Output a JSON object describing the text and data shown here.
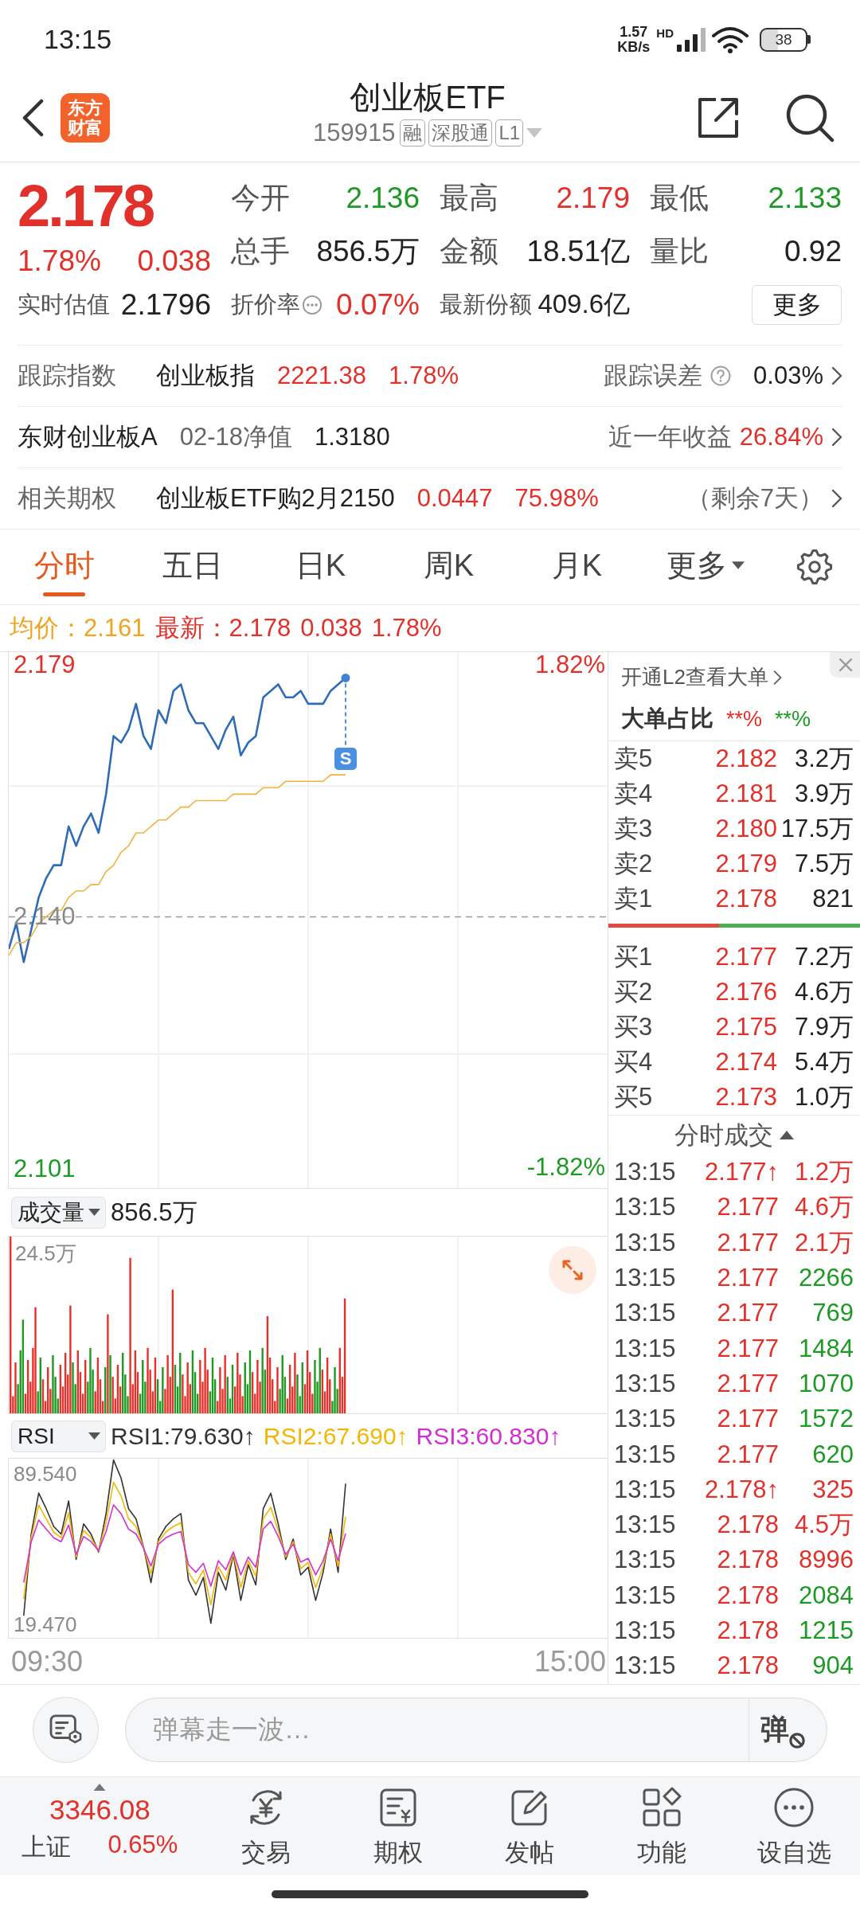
{
  "status_bar": {
    "time": "13:15",
    "speed": "1.57",
    "speed_unit": "KB/s",
    "network": "HD",
    "battery": "38"
  },
  "header": {
    "logo": "东方财富",
    "title": "创业板ETF",
    "code": "159915",
    "tags": [
      "融",
      "深股通",
      "L1"
    ]
  },
  "quote": {
    "price": "2.178",
    "change_pct": "1.78%",
    "change": "0.038",
    "color": "#e2302b",
    "stats": [
      {
        "label": "今开",
        "value": "2.136",
        "color": "#1c9a24"
      },
      {
        "label": "最高",
        "value": "2.179",
        "color": "#e2302b"
      },
      {
        "label": "最低",
        "value": "2.133",
        "color": "#1c9a24"
      },
      {
        "label": "总手",
        "value": "856.5万",
        "color": "#222222"
      },
      {
        "label": "金额",
        "value": "18.51亿",
        "color": "#222222"
      },
      {
        "label": "量比",
        "value": "0.92",
        "color": "#222222"
      }
    ],
    "details": [
      {
        "label": "实时估值",
        "value": "2.1796",
        "color": "#222222",
        "info": false
      },
      {
        "label": "折价率",
        "value": "0.07%",
        "color": "#e2302b",
        "info": true
      },
      {
        "label": "最新份额",
        "value": "409.6亿",
        "color": "#222222",
        "info": false
      }
    ],
    "more_button": "更多"
  },
  "info_rows": [
    {
      "help": true,
      "left": [
        {
          "text": "跟踪指数",
          "color": "#666666"
        },
        {
          "text": "创业板指",
          "color": "#222222"
        },
        {
          "text": "2221.38",
          "color": "#e2302b"
        },
        {
          "text": "1.78%",
          "color": "#e2302b"
        }
      ],
      "right": [
        {
          "text": "跟踪误差",
          "color": "#666666"
        },
        {
          "text": "0.03%",
          "color": "#222222"
        }
      ]
    },
    {
      "help": false,
      "left": [
        {
          "text": "东财创业板A",
          "color": "#222222"
        },
        {
          "text": "02-18净值",
          "color": "#666666"
        },
        {
          "text": "1.3180",
          "color": "#222222"
        }
      ],
      "right": [
        {
          "text": "近一年收益",
          "color": "#666666"
        },
        {
          "text": "26.84%",
          "color": "#e2302b"
        }
      ]
    },
    {
      "help": false,
      "left": [
        {
          "text": "相关期权",
          "color": "#666666"
        },
        {
          "text": "创业板ETF购2月2150",
          "color": "#222222"
        },
        {
          "text": "0.0447",
          "color": "#e2302b"
        },
        {
          "text": "75.98%",
          "color": "#e2302b"
        }
      ],
      "right": [
        {
          "text": "（剩余7天）",
          "color": "#666666"
        }
      ]
    }
  ],
  "tabs": [
    {
      "label": "分时",
      "selected": true,
      "dropdown": false
    },
    {
      "label": "五日",
      "selected": false,
      "dropdown": false
    },
    {
      "label": "日K",
      "selected": false,
      "dropdown": false
    },
    {
      "label": "周K",
      "selected": false,
      "dropdown": false
    },
    {
      "label": "月K",
      "selected": false,
      "dropdown": false
    },
    {
      "label": "更多",
      "selected": false,
      "dropdown": true
    }
  ],
  "legend": {
    "average": "均价：2.161",
    "latest": "最新：2.178",
    "change": "0.038",
    "change_pct": "1.78%"
  },
  "price_chart": {
    "top_pct": "1.82%",
    "bottom_pct": "-1.82%",
    "chart_data": {
      "type": "line",
      "grid": true,
      "categories": [
        null,
        null,
        null,
        null,
        null,
        null,
        null,
        null,
        null,
        null,
        null,
        null,
        null,
        null,
        null,
        null,
        null,
        null,
        null,
        null,
        null,
        null,
        null,
        null,
        null,
        null,
        null,
        null,
        null,
        null,
        null,
        null,
        null,
        null,
        null,
        null,
        null,
        null,
        null,
        null,
        null,
        null,
        null,
        null,
        null,
        null,
        null,
        null,
        null,
        null,
        null,
        null,
        null,
        null,
        null,
        null,
        null,
        null,
        null,
        null,
        null,
        null,
        null,
        null,
        null,
        null,
        null,
        null,
        null,
        null,
        null,
        null,
        null,
        null,
        null,
        null,
        null,
        null,
        null,
        null,
        null
      ],
      "ylim": [
        2.098,
        2.181
      ],
      "yticks": [
        {
          "value": 2.179,
          "label": "2.179"
        },
        {
          "value": 2.14,
          "label": "2.140"
        },
        {
          "value": 2.101,
          "label": "2.101"
        }
      ],
      "ref_lines": [
        {
          "axis": "y",
          "value": 2.14
        }
      ],
      "series": [
        {
          "color": "#2f6cb5",
          "values": [
            2.135,
            2.139,
            2.133,
            2.138,
            2.143,
            2.146,
            2.148,
            2.148,
            2.154,
            2.151,
            2.154,
            2.156,
            2.153,
            2.159,
            2.168,
            2.167,
            2.169,
            2.173,
            2.168,
            2.166,
            2.172,
            2.17,
            2.175,
            2.176,
            2.172,
            2.17,
            2.17,
            2.168,
            2.166,
            2.169,
            2.171,
            2.165,
            2.167,
            2.168,
            2.174,
            2.175,
            2.176,
            2.174,
            2.174,
            2.175,
            2.173,
            2.173,
            2.173,
            2.175,
            2.176,
            2.177,
            null,
            null,
            null,
            null,
            null,
            null,
            null,
            null,
            null,
            null,
            null,
            null,
            null,
            null,
            null,
            null,
            null,
            null,
            null,
            null,
            null,
            null,
            null,
            null,
            null,
            null,
            null,
            null,
            null,
            null,
            null,
            null,
            null,
            null,
            null
          ]
        },
        {
          "color": "#f2b33d",
          "values": [
            2.134,
            2.136,
            2.136,
            2.137,
            2.139,
            2.14,
            2.141,
            2.141,
            2.143,
            2.144,
            2.144,
            2.145,
            2.145,
            2.147,
            2.148,
            2.15,
            2.151,
            2.153,
            2.153,
            2.154,
            2.155,
            2.155,
            2.156,
            2.157,
            2.157,
            2.158,
            2.158,
            2.158,
            2.158,
            2.158,
            2.159,
            2.159,
            2.159,
            2.159,
            2.16,
            2.16,
            2.16,
            2.161,
            2.161,
            2.161,
            2.161,
            2.161,
            2.161,
            2.162,
            2.162,
            2.162,
            null,
            null,
            null,
            null,
            null,
            null,
            null,
            null,
            null,
            null,
            null,
            null,
            null,
            null,
            null,
            null,
            null,
            null,
            null,
            null,
            null,
            null,
            null,
            null,
            null,
            null,
            null,
            null,
            null,
            null,
            null,
            null,
            null,
            null,
            null
          ]
        }
      ],
      "annotations": [
        "S"
      ]
    }
  },
  "volume": {
    "selector": "成交量",
    "total": "856.5万",
    "max_label": "24.5万"
  },
  "rsi": {
    "selector": "RSI",
    "readings": [
      {
        "text": "RSI1:79.630↑",
        "color": "#333333"
      },
      {
        "text": "RSI2:67.690↑",
        "color": "#f2b705"
      },
      {
        "text": "RSI3:60.830↑",
        "color": "#d42fd4"
      }
    ],
    "chart_data": {
      "type": "line",
      "grid": true,
      "categories": [
        null,
        null,
        null,
        null,
        null,
        null,
        null,
        null,
        null,
        null,
        null,
        null,
        null,
        null,
        null,
        null,
        null,
        null,
        null,
        null,
        null,
        null,
        null,
        null,
        null,
        null,
        null,
        null,
        null,
        null,
        null,
        null,
        null,
        null,
        null,
        null,
        null,
        null,
        null,
        null,
        null,
        null,
        null,
        null,
        null,
        null,
        null,
        null,
        null,
        null,
        null,
        null,
        null,
        null,
        null,
        null,
        null,
        null,
        null,
        null,
        null,
        null,
        null,
        null,
        null,
        null,
        null,
        null,
        null,
        null,
        null,
        null,
        null,
        null,
        null,
        null,
        null,
        null,
        null,
        null,
        null
      ],
      "ylim": [
        13.1,
        96.7
      ],
      "yticks": [
        {
          "value": 89.54,
          "label": "89.540"
        },
        {
          "value": 19.47,
          "label": "19.470"
        }
      ],
      "series": [
        {
          "color": "#333333",
          "values": [
            null,
            null,
            23.5,
            61.5,
            80.7,
            73.4,
            65.1,
            61.5,
            77.0,
            49.7,
            66.3,
            61.5,
            53.2,
            71.1,
            96.1,
            87.7,
            73.4,
            68.7,
            55.6,
            38.9,
            59.2,
            65.1,
            68.7,
            71.1,
            40.1,
            33.0,
            41.3,
            19.9,
            43.7,
            35.4,
            52.0,
            30.6,
            47.3,
            37.8,
            73.4,
            80.6,
            66.3,
            49.7,
            59.2,
            42.5,
            46.1,
            30.6,
            43.7,
            63.9,
            43.7,
            85.1,
            null,
            null,
            null,
            null,
            null,
            null,
            null,
            null,
            null,
            null,
            null,
            null,
            null,
            null,
            null,
            null,
            null,
            null,
            null,
            null,
            null,
            null,
            null,
            null,
            null,
            null,
            null,
            null,
            null,
            null,
            null,
            null,
            null,
            null,
            null
          ]
        },
        {
          "color": "#f2b705",
          "values": [
            null,
            null,
            31.2,
            59.8,
            75.0,
            68.7,
            62.5,
            59.8,
            71.4,
            50.8,
            63.3,
            59.8,
            53.6,
            66.9,
            85.7,
            79.4,
            68.7,
            65.1,
            55.4,
            42.9,
            58.0,
            62.5,
            65.1,
            66.9,
            43.7,
            38.3,
            44.7,
            28.6,
            46.4,
            40.1,
            52.6,
            36.6,
            49.1,
            41.9,
            68.7,
            74.0,
            63.3,
            50.8,
            58.0,
            45.5,
            48.2,
            36.6,
            46.4,
            61.6,
            46.4,
            69.6,
            null,
            null,
            null,
            null,
            null,
            null,
            null,
            null,
            null,
            null,
            null,
            null,
            null,
            null,
            null,
            null,
            null,
            null,
            null,
            null,
            null,
            null,
            null,
            null,
            null,
            null,
            null,
            null,
            null,
            null,
            null,
            null,
            null,
            null,
            null
          ]
        },
        {
          "color": "#d42fd4",
          "values": [
            null,
            null,
            39.0,
            58.0,
            68.1,
            63.9,
            59.8,
            58.0,
            65.7,
            52.0,
            60.4,
            58.0,
            53.8,
            62.7,
            75.2,
            71.1,
            63.9,
            61.6,
            55.0,
            46.7,
            56.8,
            59.8,
            61.6,
            62.7,
            47.3,
            43.7,
            47.9,
            37.2,
            49.1,
            44.9,
            53.2,
            42.5,
            50.8,
            46.1,
            63.9,
            67.5,
            60.4,
            52.0,
            56.8,
            48.5,
            50.2,
            42.5,
            49.1,
            59.2,
            49.1,
            61.8,
            null,
            null,
            null,
            null,
            null,
            null,
            null,
            null,
            null,
            null,
            null,
            null,
            null,
            null,
            null,
            null,
            null,
            null,
            null,
            null,
            null,
            null,
            null,
            null,
            null,
            null,
            null,
            null,
            null,
            null,
            null,
            null,
            null,
            null,
            null
          ]
        }
      ]
    },
    "time_axis": [
      "09:30",
      "15:00"
    ]
  },
  "order_book": {
    "l2_link": "开通L2查看大单",
    "big_order_label": "大单占比",
    "big_buy": "**%",
    "big_sell": "**%",
    "asks": [
      {
        "label": "卖5",
        "price": "2.182",
        "volume": "3.2万"
      },
      {
        "label": "卖4",
        "price": "2.181",
        "volume": "3.9万"
      },
      {
        "label": "卖3",
        "price": "2.180",
        "volume": "17.5万"
      },
      {
        "label": "卖2",
        "price": "2.179",
        "volume": "7.5万"
      },
      {
        "label": "卖1",
        "price": "2.178",
        "volume": "821"
      }
    ],
    "ratio_bar": {
      "level": 0.44
    },
    "bids": [
      {
        "label": "买1",
        "price": "2.177",
        "volume": "7.2万"
      },
      {
        "label": "买2",
        "price": "2.176",
        "volume": "4.6万"
      },
      {
        "label": "买3",
        "price": "2.175",
        "volume": "7.9万"
      },
      {
        "label": "买4",
        "price": "2.174",
        "volume": "5.4万"
      },
      {
        "label": "买5",
        "price": "2.173",
        "volume": "1.0万"
      }
    ],
    "trades_title": "分时成交",
    "trades": [
      {
        "time": "13:15",
        "price": "2.177↑",
        "volume": "1.2万",
        "color": "#e2302b"
      },
      {
        "time": "13:15",
        "price": "2.177",
        "volume": "4.6万",
        "color": "#e2302b"
      },
      {
        "time": "13:15",
        "price": "2.177",
        "volume": "2.1万",
        "color": "#e2302b"
      },
      {
        "time": "13:15",
        "price": "2.177",
        "volume": "2266",
        "color": "#1c9a24"
      },
      {
        "time": "13:15",
        "price": "2.177",
        "volume": "769",
        "color": "#1c9a24"
      },
      {
        "time": "13:15",
        "price": "2.177",
        "volume": "1484",
        "color": "#1c9a24"
      },
      {
        "time": "13:15",
        "price": "2.177",
        "volume": "1070",
        "color": "#1c9a24"
      },
      {
        "time": "13:15",
        "price": "2.177",
        "volume": "1572",
        "color": "#1c9a24"
      },
      {
        "time": "13:15",
        "price": "2.177",
        "volume": "620",
        "color": "#1c9a24"
      },
      {
        "time": "13:15",
        "price": "2.178↑",
        "volume": "325",
        "color": "#e2302b"
      },
      {
        "time": "13:15",
        "price": "2.178",
        "volume": "4.5万",
        "color": "#e2302b"
      },
      {
        "time": "13:15",
        "price": "2.178",
        "volume": "8996",
        "color": "#e2302b"
      },
      {
        "time": "13:15",
        "price": "2.178",
        "volume": "2084",
        "color": "#1c9a24"
      },
      {
        "time": "13:15",
        "price": "2.178",
        "volume": "1215",
        "color": "#1c9a24"
      },
      {
        "time": "13:15",
        "price": "2.178",
        "volume": "904",
        "color": "#1c9a24"
      }
    ]
  },
  "comment_bar": {
    "placeholder": "弹幕走一波…",
    "toggle": "弹"
  },
  "bottom_nav": {
    "index": {
      "value": "3346.08",
      "name": "上证",
      "change": "0.65%",
      "color": "#e2302b"
    },
    "items": [
      "交易",
      "期权",
      "发帖",
      "功能",
      "设自选"
    ]
  }
}
